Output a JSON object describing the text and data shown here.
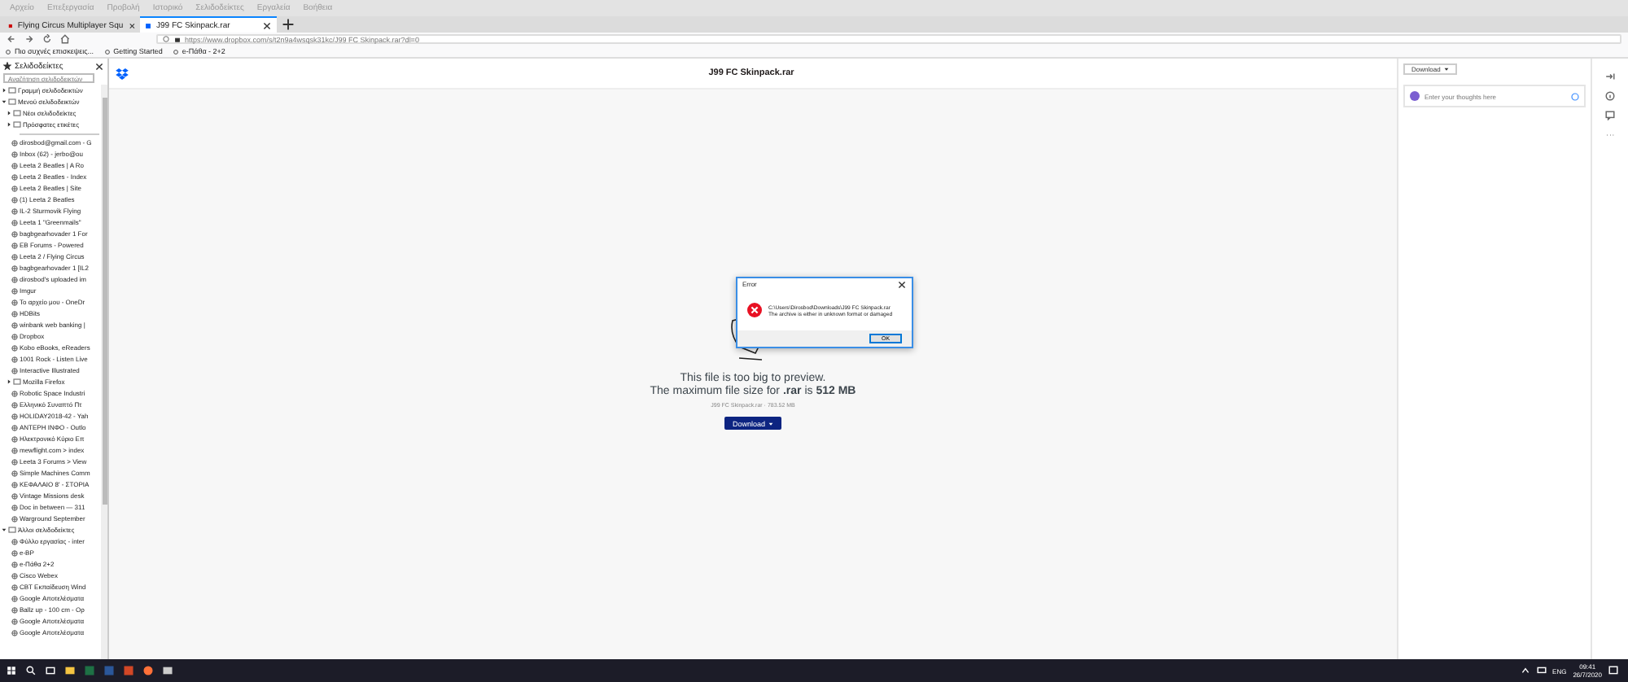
{
  "menu_bar": [
    "Αρχείο",
    "Επεξεργασία",
    "Προβολή",
    "Ιστορικό",
    "Σελιδοδείκτες",
    "Εργαλεία",
    "Βοήθεια"
  ],
  "tabs": [
    {
      "title": "Flying Circus Multiplayer Squ",
      "selected": false
    },
    {
      "title": "J99 FC Skinpack.rar",
      "selected": true
    }
  ],
  "address_bar": {
    "url": "https://www.dropbox.com/s/t2n9a4wsqsk31kc/J99 FC Skinpack.rar?dl=0"
  },
  "bookmarks_toolbar": [
    "Πιο συχνές επισκεψεις...",
    "Getting Started",
    "e-Πάθα - 2+2"
  ],
  "sidebar": {
    "title": "Σελιδοδείκτες",
    "search_placeholder": "Αναζήτηση σελιδοδεικτών",
    "tree": [
      {
        "kind": "folder",
        "label": "Γραμμή σελιδοδεικτών",
        "expanded": false
      },
      {
        "kind": "folder",
        "label": "Μενού σελιδοδεικτών",
        "expanded": true,
        "children": [
          {
            "kind": "folder",
            "label": "Νέοι σελιδοδείκτες",
            "expanded": false
          },
          {
            "kind": "folder",
            "label": "Πρόσφατες ετικέτες",
            "expanded": false
          },
          {
            "kind": "separator"
          },
          {
            "kind": "bookmark",
            "label": "dirosbod@gmail.com - G"
          },
          {
            "kind": "bookmark",
            "label": "Inbox (62) - jerbo@ou"
          },
          {
            "kind": "bookmark",
            "label": "Leeta 2 Beatles | A Ro"
          },
          {
            "kind": "bookmark",
            "label": "Leeta 2 Beatles - Index"
          },
          {
            "kind": "bookmark",
            "label": "Leeta 2 Beatles | Site"
          },
          {
            "kind": "bookmark",
            "label": "(1) Leeta 2 Beatles"
          },
          {
            "kind": "bookmark",
            "label": "IL-2 Sturmovik Flying"
          },
          {
            "kind": "bookmark",
            "label": "Leeta 1 \"Greenmails\""
          },
          {
            "kind": "bookmark",
            "label": "bagbgearhovader 1 For"
          },
          {
            "kind": "bookmark",
            "label": "EB Forums - Powered"
          },
          {
            "kind": "bookmark",
            "label": "Leeta 2 / Flying Circus"
          },
          {
            "kind": "bookmark",
            "label": "bagbgearhovader 1 [IL2"
          },
          {
            "kind": "bookmark",
            "label": "dirosbod's uploaded im"
          },
          {
            "kind": "bookmark",
            "label": "Imgur"
          },
          {
            "kind": "bookmark",
            "label": "Το αρχείο μου - OneDr"
          },
          {
            "kind": "bookmark",
            "label": "HDBits"
          },
          {
            "kind": "bookmark",
            "label": "winbank web banking |"
          },
          {
            "kind": "bookmark",
            "label": "Dropbox"
          },
          {
            "kind": "bookmark",
            "label": "Kobo eBooks, eReaders"
          },
          {
            "kind": "bookmark",
            "label": "1001 Rock - Listen Live"
          },
          {
            "kind": "bookmark",
            "label": "Interactive Illustrated"
          },
          {
            "kind": "folder",
            "label": "Mozilla Firefox",
            "expanded": false
          },
          {
            "kind": "bookmark",
            "label": "Robotic Space Industri"
          },
          {
            "kind": "bookmark",
            "label": "Ελληνικό Συναπτό Πτ"
          },
          {
            "kind": "bookmark",
            "label": "HOLIDAY2018-42 - Yah"
          },
          {
            "kind": "bookmark",
            "label": "ΑΝΤΕΡΗ ΙΝΦΟ - Outlo"
          },
          {
            "kind": "bookmark",
            "label": "Ηλεκτρονικό Κύριο Επ"
          },
          {
            "kind": "bookmark",
            "label": "mewflight.com > index"
          },
          {
            "kind": "bookmark",
            "label": "Leeta 3 Forums > View"
          },
          {
            "kind": "bookmark",
            "label": "Simple Machines Comm"
          },
          {
            "kind": "bookmark",
            "label": "ΚΕΦΑΛΑΙΟ 8' - ΣΤΟΡΙΑ"
          },
          {
            "kind": "bookmark",
            "label": "Vintage Missions desk"
          },
          {
            "kind": "bookmark",
            "label": "Doc in between — 311"
          },
          {
            "kind": "bookmark",
            "label": "Warground September"
          }
        ]
      },
      {
        "kind": "folder",
        "label": "Άλλοι σελιδοδείκτες",
        "expanded": true,
        "children": [
          {
            "kind": "bookmark",
            "label": "Φύλλο εργασίας - inter"
          },
          {
            "kind": "bookmark",
            "label": "e-BP"
          },
          {
            "kind": "bookmark",
            "label": "e-Πάθα 2+2"
          },
          {
            "kind": "bookmark",
            "label": "Cisco Webex"
          },
          {
            "kind": "bookmark",
            "label": "CBT Εκπαίδευση Wind"
          },
          {
            "kind": "bookmark",
            "label": "Google Αποτελέσματα"
          },
          {
            "kind": "bookmark",
            "label": "Ballz up - 100 cm - Ορ"
          },
          {
            "kind": "bookmark",
            "label": "Google Αποτελέσματα"
          },
          {
            "kind": "bookmark",
            "label": "Google Αποτελέσματα"
          }
        ]
      }
    ]
  },
  "file_page": {
    "title": "J99 FC Skinpack.rar",
    "message_lines": [
      "This file is too big to preview.",
      "The maximum file size for **.rar** is **512 MB**"
    ],
    "file_info": "J99 FC Skinpack.rar · 783.52 MB",
    "download_button": "Download"
  },
  "dialog": {
    "title": "Error",
    "path": "C:\\Users\\Dirosbod\\Downloads\\J99 FC Skinpack.rar",
    "message": "The archive is either in unknown format or damaged",
    "ok_button": "OK"
  },
  "side_panel": {
    "download_button": "Download",
    "comment_placeholder": "Enter your thoughts here"
  },
  "taskbar": {
    "language": "ENG",
    "time": "09:41",
    "date": "26/7/2020"
  }
}
